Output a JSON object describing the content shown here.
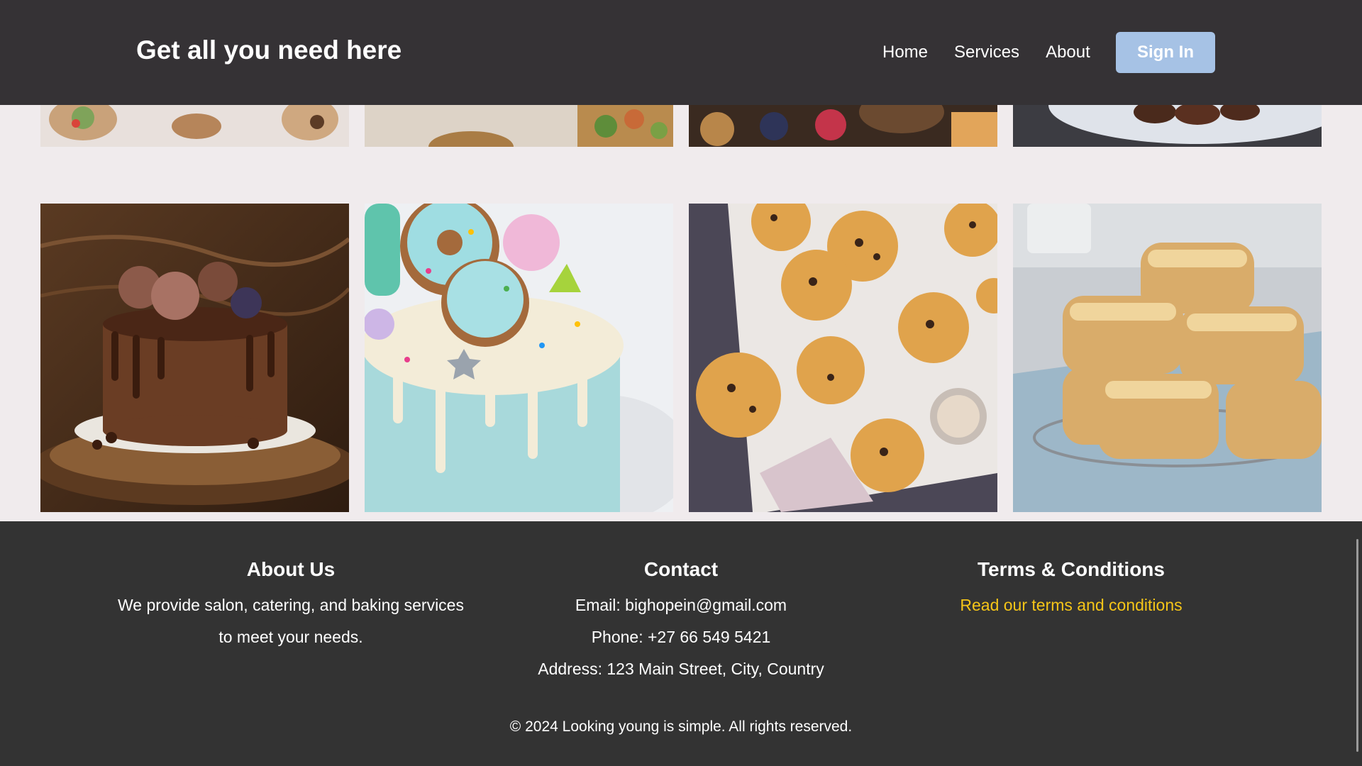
{
  "header": {
    "title": "Get all you need here",
    "nav": [
      "Home",
      "Services",
      "About"
    ],
    "signin_label": "Sign In"
  },
  "colors": {
    "header_bg": "#353235",
    "page_bg": "#f0ebed",
    "footer_bg": "#333333",
    "signin_bg": "#a6c2e5",
    "link_accent": "#f5c518"
  },
  "gallery": {
    "row1": [
      "food-platter-image",
      "salad-spread-image",
      "dessert-table-image",
      "grilled-meat-plate-image"
    ],
    "row2": [
      "chocolate-drip-cake-image",
      "sprinkle-donut-cake-image",
      "chocolate-chip-muffins-image",
      "scones-image"
    ]
  },
  "footer": {
    "about": {
      "heading": "About Us",
      "lines": [
        "We provide salon, catering, and baking services",
        "to meet your needs."
      ]
    },
    "contact": {
      "heading": "Contact",
      "email": "Email: bighopein@gmail.com",
      "phone": "Phone: +27 66 549 5421",
      "address": "Address: 123 Main Street, City, Country"
    },
    "terms": {
      "heading": "Terms & Conditions",
      "link": "Read our terms and conditions"
    },
    "copyright": "© 2024 Looking young is simple. All rights reserved."
  }
}
